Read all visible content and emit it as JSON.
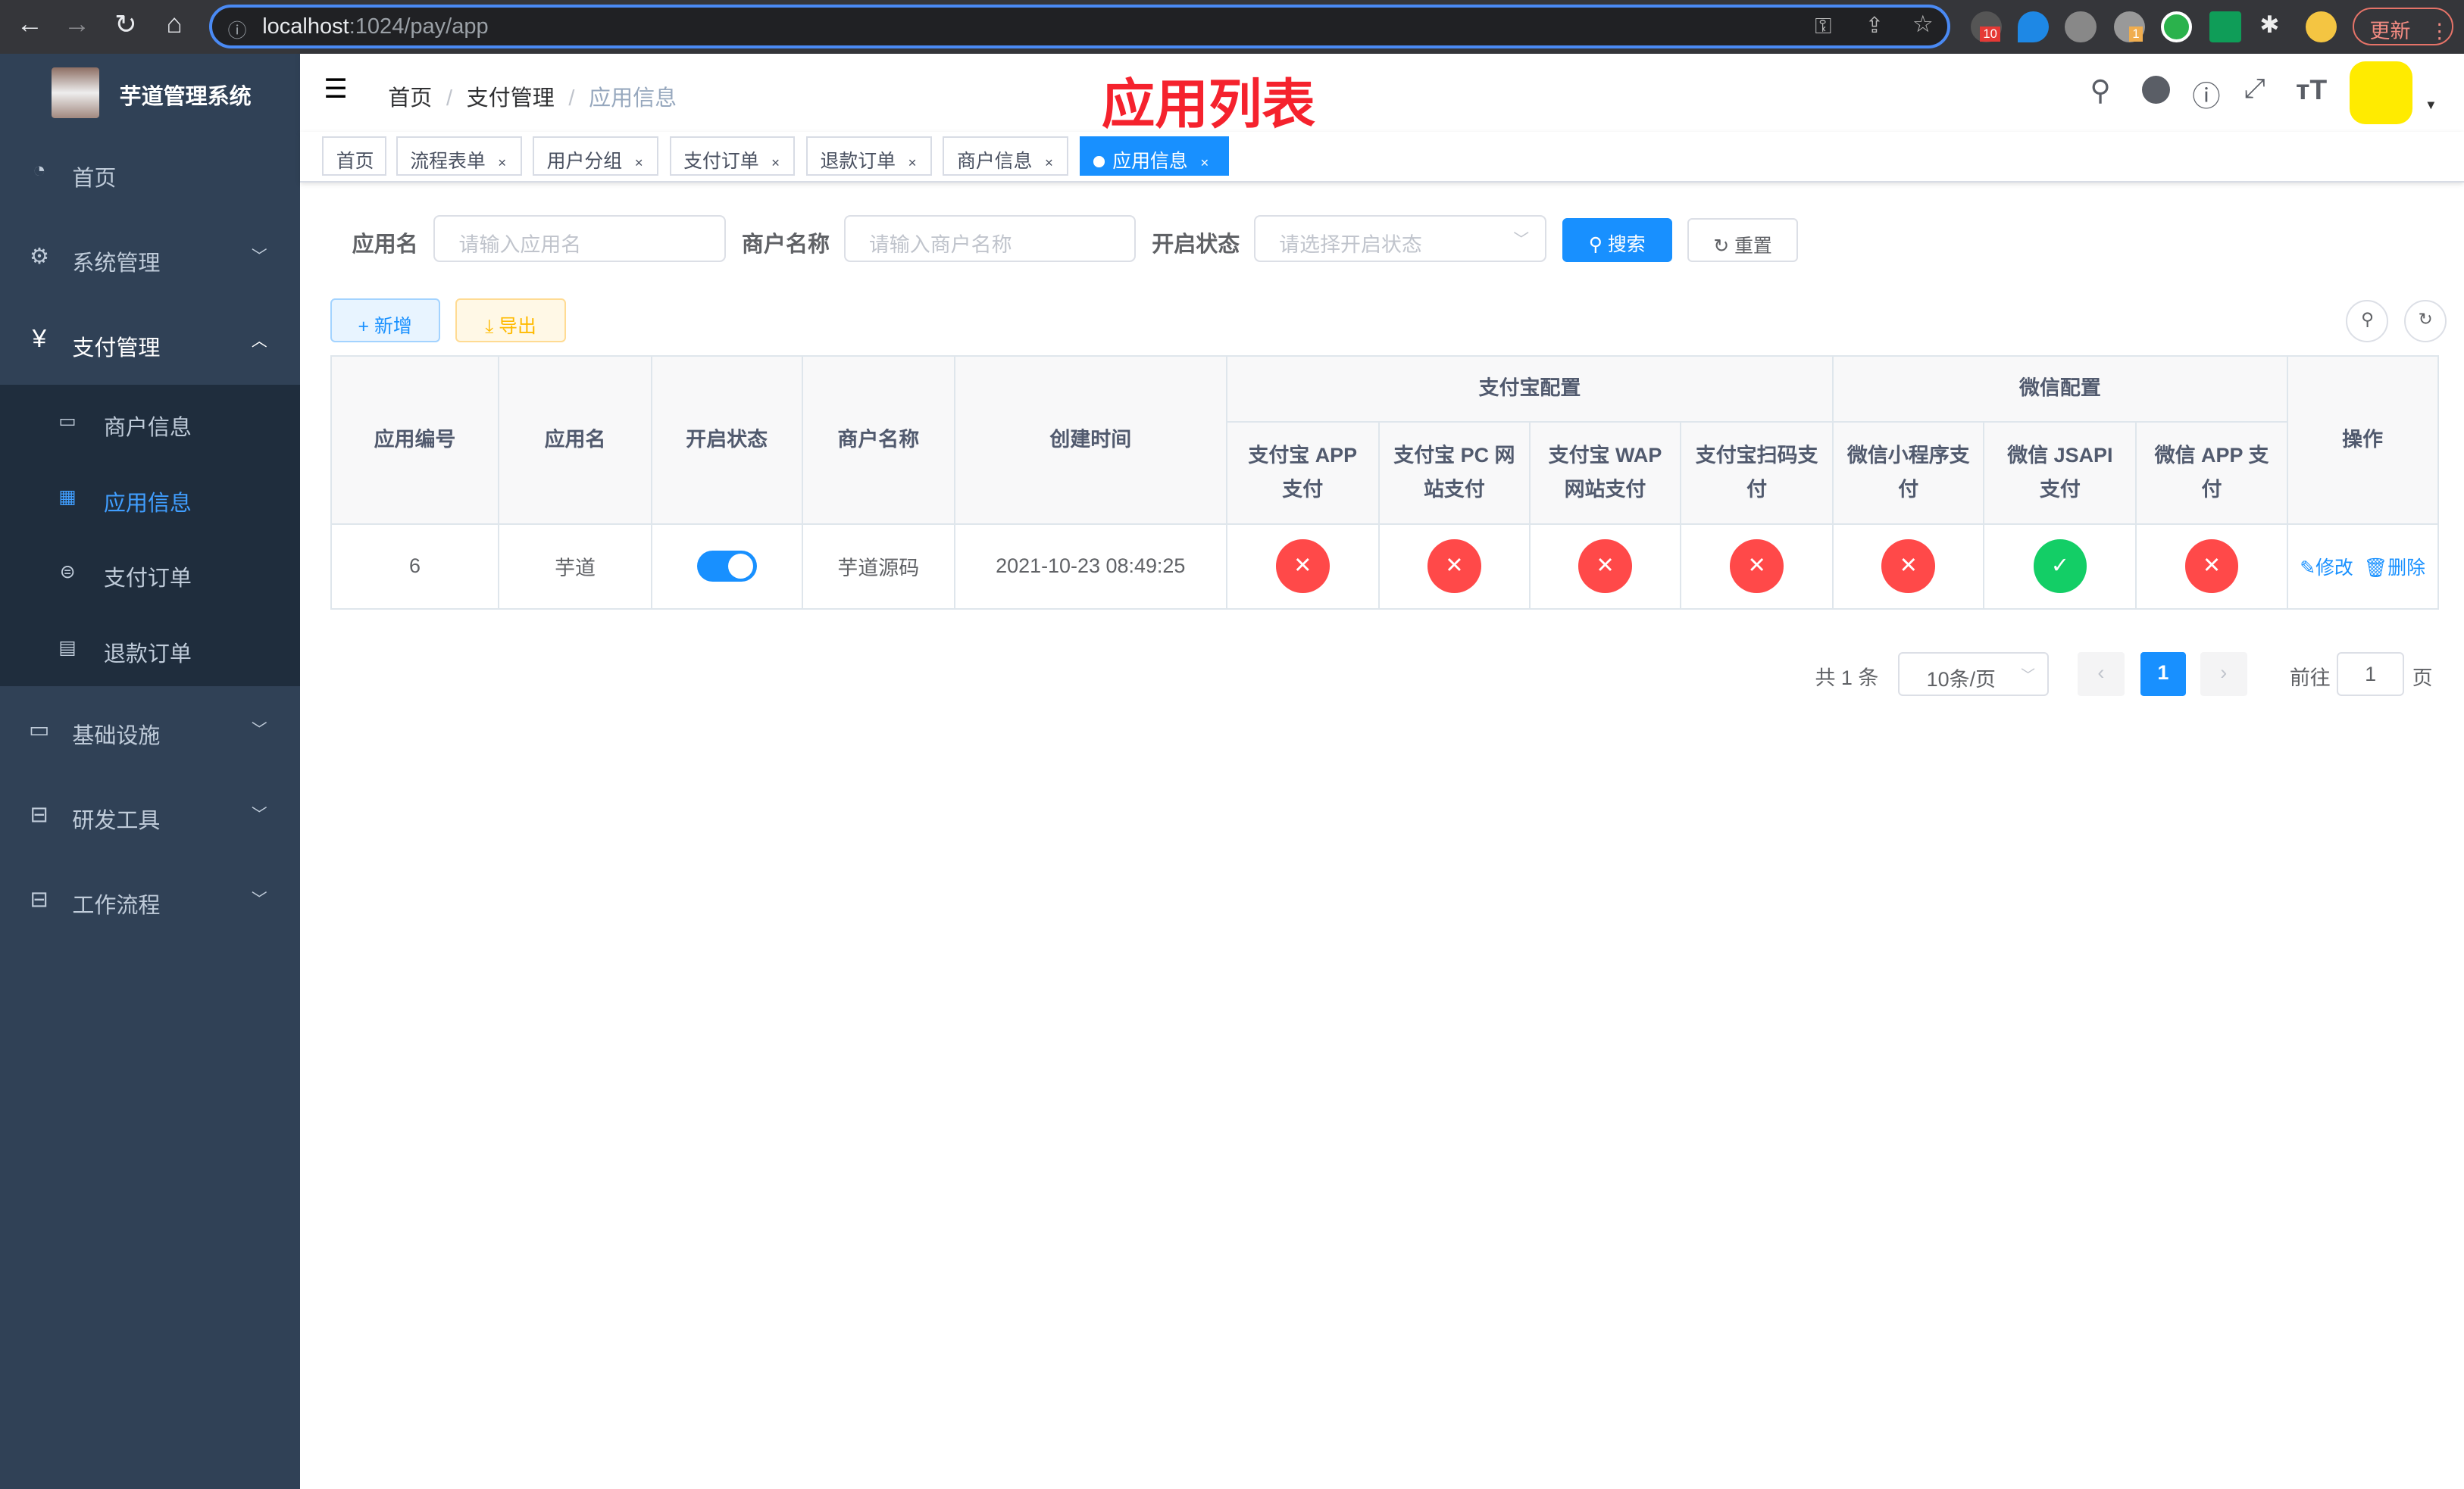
{
  "browser": {
    "url_host": "localhost",
    "url_path": ":1024/pay/app",
    "update_label": "更新",
    "ext_badge_1": "10",
    "ext_badge_2": "1"
  },
  "sidebar": {
    "title": "芋道管理系统",
    "items": [
      {
        "label": "首页",
        "icon": "dashboard-icon"
      },
      {
        "label": "系统管理",
        "icon": "gear-icon"
      },
      {
        "label": "支付管理",
        "icon": "yen-icon"
      },
      {
        "label": "基础设施",
        "icon": "monitor-icon"
      },
      {
        "label": "研发工具",
        "icon": "toolbox-icon"
      },
      {
        "label": "工作流程",
        "icon": "toolbox-icon"
      }
    ],
    "sub_items": [
      {
        "label": "商户信息"
      },
      {
        "label": "应用信息",
        "active": true
      },
      {
        "label": "支付订单"
      },
      {
        "label": "退款订单"
      }
    ]
  },
  "navbar": {
    "breadcrumb": [
      "首页",
      "支付管理",
      "应用信息"
    ],
    "annotation": "应用列表"
  },
  "tags": [
    {
      "label": "首页"
    },
    {
      "label": "流程表单"
    },
    {
      "label": "用户分组"
    },
    {
      "label": "支付订单"
    },
    {
      "label": "退款订单"
    },
    {
      "label": "商户信息"
    },
    {
      "label": "应用信息",
      "active": true
    }
  ],
  "search": {
    "app_name_label": "应用名",
    "app_name_placeholder": "请输入应用名",
    "merchant_label": "商户名称",
    "merchant_placeholder": "请输入商户名称",
    "status_label": "开启状态",
    "status_placeholder": "请选择开启状态",
    "search_button": "搜索",
    "reset_button": "重置"
  },
  "toolbar": {
    "add_button": "新增",
    "export_button": "导出"
  },
  "table": {
    "headers": {
      "id": "应用编号",
      "name": "应用名",
      "status": "开启状态",
      "merchant": "商户名称",
      "created": "创建时间",
      "alipay_group": "支付宝配置",
      "wechat_group": "微信配置",
      "actions": "操作",
      "alipay": [
        "支付宝 APP 支付",
        "支付宝 PC 网站支付",
        "支付宝 WAP 网站支付",
        "支付宝扫码支付"
      ],
      "wechat": [
        "微信小程序支付",
        "微信 JSAPI 支付",
        "微信 APP 支付"
      ]
    },
    "rows": [
      {
        "id": "6",
        "name": "芋道",
        "status_enabled": true,
        "merchant": "芋道源码",
        "created": "2021-10-23 08:49:25",
        "alipay": [
          false,
          false,
          false,
          false
        ],
        "wechat": [
          false,
          true,
          false
        ],
        "edit": "修改",
        "delete": "删除"
      }
    ]
  },
  "pagination": {
    "total": "共 1 条",
    "page_size": "10条/页",
    "current_page": "1",
    "goto_label": "前往",
    "goto_value": "1",
    "page_suffix": "页"
  },
  "colors": {
    "primary": "#1890ff",
    "sidebar": "#304156",
    "danger": "#ff4949",
    "success": "#13ce66"
  }
}
